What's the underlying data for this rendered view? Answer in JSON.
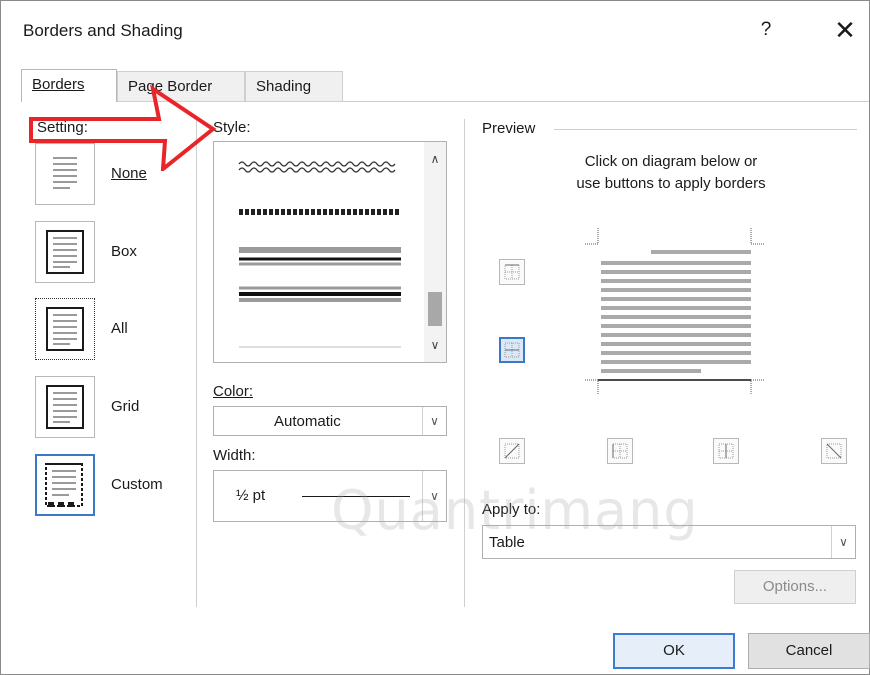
{
  "dialog": {
    "title": "Borders and Shading",
    "help_label": "?",
    "close_label": "✕"
  },
  "tabs": [
    {
      "label": "Borders",
      "active": true
    },
    {
      "label": "Page Border",
      "active": false
    },
    {
      "label": "Shading",
      "active": false
    }
  ],
  "setting": {
    "label": "Setting:",
    "options": [
      {
        "label": "None",
        "icon": "border-none-icon"
      },
      {
        "label": "Box",
        "icon": "border-box-icon"
      },
      {
        "label": "All",
        "icon": "border-all-icon",
        "selected_outline": true
      },
      {
        "label": "Grid",
        "icon": "border-grid-icon"
      },
      {
        "label": "Custom",
        "icon": "border-custom-icon",
        "selected": true
      }
    ]
  },
  "style": {
    "label": "Style:",
    "up_arrow": "∧",
    "down_arrow": "∨"
  },
  "color": {
    "label": "Color:",
    "value": "Automatic"
  },
  "width": {
    "label": "Width:",
    "value": "½ pt"
  },
  "preview": {
    "label": "Preview",
    "hint_line1": "Click on diagram below or",
    "hint_line2": "use buttons to apply borders"
  },
  "apply_to": {
    "label": "Apply to:",
    "value": "Table"
  },
  "buttons": {
    "options": "Options...",
    "ok": "OK",
    "cancel": "Cancel"
  },
  "watermark_text": "Quantrimang",
  "colors": {
    "accent": "#3c78c8",
    "arrow": "#e8262a"
  }
}
